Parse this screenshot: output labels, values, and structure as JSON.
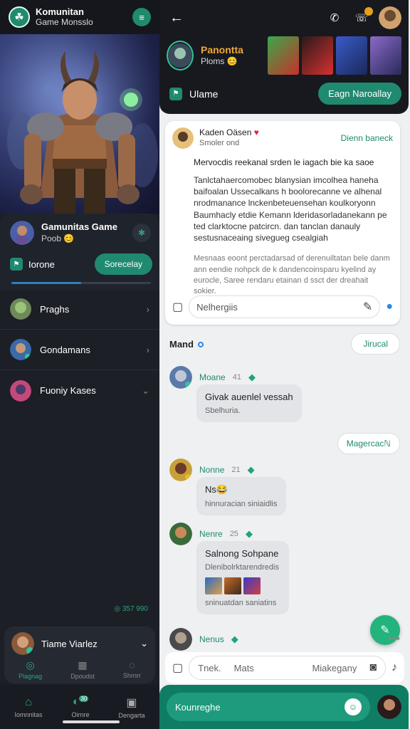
{
  "left": {
    "app_title": "Komunitan",
    "app_subtitle": "Game Monsslo",
    "card": {
      "name": "Gamunitas Game",
      "sub": "Poob 😊",
      "row_label": "Iorone",
      "row_button": "Sorecelay",
      "progress": 0.5
    },
    "items": [
      {
        "label": "Praghs"
      },
      {
        "label": "Gondamans"
      },
      {
        "label": "Fuoniy Kases"
      }
    ],
    "count_label": "◎ 357 990",
    "footer_name": "Tiame Viarlez",
    "footer_tabs": [
      "Plagnag",
      "Dpoudst",
      "Shrnrr"
    ],
    "nav": [
      "Iomnnitas",
      "Oirnre",
      "Dengarta"
    ],
    "nav_badge": "30"
  },
  "right": {
    "profile_name": "Panontta",
    "profile_sub": "Ploms 😊",
    "action_label": "Ulame",
    "action_button": "Eagn Naroallay",
    "post": {
      "author": "Kaden Oäsen",
      "author_sub": "Smoler ond",
      "follow": "Dienn baneck",
      "line1": "Mervocdis reekanal srden le iagach bie ka saoe",
      "para": "Tanlctahaercomobec blanysian imcolhea haneha baifoalan Ussecalkans h boolorecanne ve alhenal nrodmanance lnckenbeteuensehan koulkoryonn Baumhacly etdie Kemann lderidasorladanekann pe ted clarktocne patcircn. dan tanclan danauly sestusnaceaing sivegueg csealgiah",
      "para2": "Mesnaas eoont perctadarsad of derenuiltatan bele danm ann eendie nohpck de k dandencoinsparu kyelind ay eurocle, Saree rendaru etainan d ssct der dreahait sokier.",
      "input_placeholder": "Nelhergiis"
    },
    "section_title": "Mand",
    "section_button": "Jirucal",
    "messages": [
      {
        "name": "Moane",
        "time": "41",
        "text": "Givak auenlel vessah",
        "sub": "Sbelhuria."
      },
      {
        "name": "Nonne",
        "time": "21",
        "text": "Ns😂",
        "sub": "hinnuracian siniaidlis"
      },
      {
        "name": "Nenre",
        "time": "25",
        "text": "Salnong Sohpane",
        "sub": "Dlenibolrktarendredis",
        "sub2": "sninuatdan saniatins"
      },
      {
        "name": "Nenus",
        "time": ""
      }
    ],
    "reply_pill": "Magercacℕ",
    "compose": {
      "a": "Tnek.",
      "b": "Mats",
      "c": "Miakegany"
    },
    "bottom_field": "Kounreghe"
  }
}
